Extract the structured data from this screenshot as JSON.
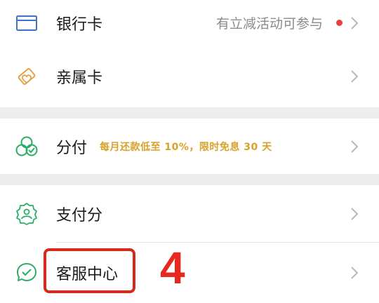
{
  "rows": {
    "bank_card": {
      "label": "银行卡",
      "hint": "有立减活动可参与"
    },
    "family_card": {
      "label": "亲属卡"
    },
    "fenfu": {
      "label": "分付",
      "promo": "每月还款低至 10%，限时免息 30 天"
    },
    "pay_score": {
      "label": "支付分"
    },
    "customer_service": {
      "label": "客服中心"
    }
  },
  "annotation": {
    "step": "4"
  },
  "colors": {
    "blue_icon": "#3d72c9",
    "orange_icon": "#e8a04a",
    "green_icon": "#2aae67",
    "promo_text": "#d8a22a",
    "red_dot": "#e64340",
    "annotation_red": "#d62a1a"
  },
  "icons": {
    "bank_card": "bank-card-icon",
    "family_card": "family-card-icon",
    "fenfu": "fenfu-icon",
    "pay_score": "pay-score-icon",
    "customer_service": "chat-service-icon",
    "chevron": "chevron-right-icon"
  }
}
